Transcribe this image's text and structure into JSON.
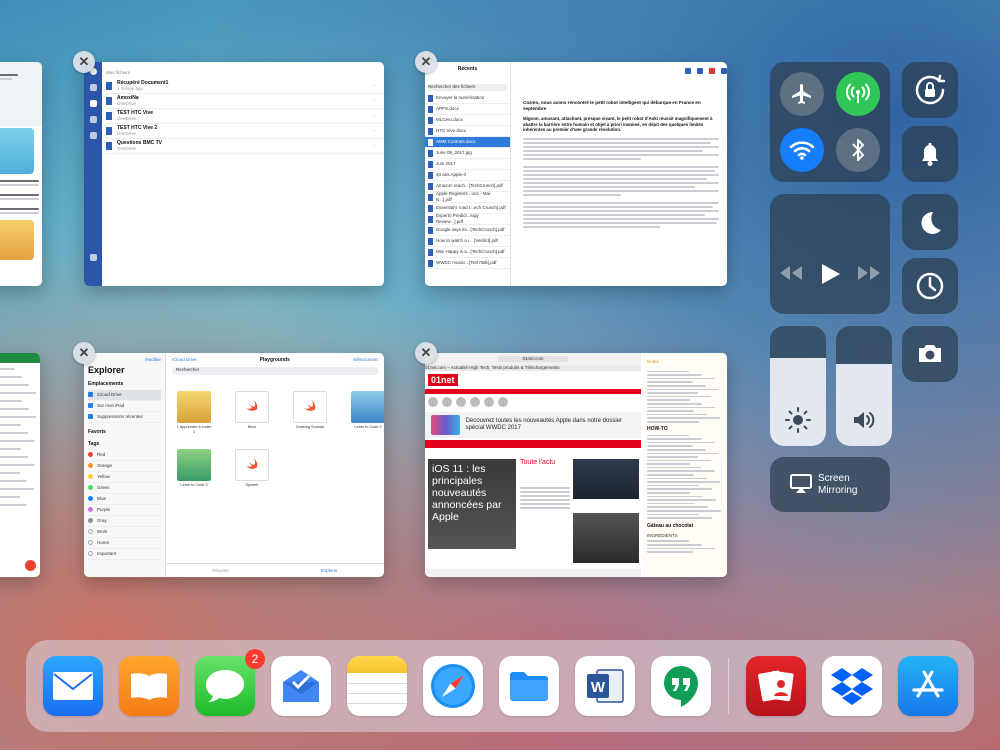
{
  "switcher": {
    "card_docs": {
      "section_label": "Mes fichiers",
      "rows": [
        {
          "name": "Récupéré Document1",
          "meta": "1 minute ago"
        },
        {
          "name": "AmoxiNa",
          "meta": "OneDrive"
        },
        {
          "name": "TEST HTC Vive",
          "meta": "OneDrive"
        },
        {
          "name": "TEST HTC Vive 2",
          "meta": "OneDrive"
        },
        {
          "name": "Questions BMC TV",
          "meta": "OneDrive"
        }
      ],
      "side_items": [
        "Récents",
        "Partagés",
        "Ouvrir",
        "Nouveau"
      ]
    },
    "card_files_doc": {
      "title": "Récents",
      "search_placeholder": "Rechercher des fichiers",
      "list": [
        {
          "name": "Envoyer la numérisation"
        },
        {
          "name": "APPS.docx"
        },
        {
          "name": "MLCero.docx"
        },
        {
          "name": "HTC Vive.docx"
        },
        {
          "name": "AMM Contrats.docx",
          "selected": true
        },
        {
          "name": "June 09_2017.jpg"
        },
        {
          "name": "Juin 2017"
        },
        {
          "name": "40 ans Apple-II"
        },
        {
          "name": "Amazon reach...[TechCrunch].pdf"
        },
        {
          "name": "Apple Registers...ons - Mar N...].pdf"
        },
        {
          "name": "Essential's road t...ech Crunch].pdf"
        },
        {
          "name": "Esperto Predict...logy Review...].pdf"
        },
        {
          "name": "Google says its...[TechCrunch].pdf"
        },
        {
          "name": "How to watch a i... [Verdict].pdf"
        },
        {
          "name": "Mini Happy is a...[TechCrunch].pdf"
        },
        {
          "name": "WWDC music!...[TechTalk].pdf"
        }
      ],
      "doc_heading": "Cozmo, nous avons rencontré le petit robot intelligent qui débarque en France en septembre",
      "doc_lead": "Mignon, amusant, attachant, presque vivant, le petit robot d'Anki réussit magnifiquement à abattre la barrière entre humain et objet à priori inanimé, en dépit des quelques limites inhérentes au premier d'une grande révolution."
    },
    "card_explorer": {
      "title": "Explorer",
      "edit": "Modifier",
      "locations_header": "Emplacements",
      "locations": [
        "iCloud Drive",
        "Sur mon iPad",
        "Suppressions récentes"
      ],
      "favorites_header": "Favoris",
      "tags_header": "Tags",
      "tags": [
        {
          "name": "Red",
          "color": "#fc3d39"
        },
        {
          "name": "Orange",
          "color": "#fd9426"
        },
        {
          "name": "Yellow",
          "color": "#fecb2e"
        },
        {
          "name": "Green",
          "color": "#53d769"
        },
        {
          "name": "Blue",
          "color": "#147efb"
        },
        {
          "name": "Purple",
          "color": "#cc73e1"
        },
        {
          "name": "Gray",
          "color": "#8e8e93"
        },
        {
          "name": "Work",
          "color": "#ffffff"
        },
        {
          "name": "Home",
          "color": "#ffffff"
        },
        {
          "name": "Important",
          "color": "#ffffff"
        }
      ],
      "back": "iCloud Drive",
      "folder_title": "Playgrounds",
      "select": "Sélectionner",
      "search_placeholder": "Rechercher",
      "files": [
        "1 Apprendre à coder 1",
        "Blink",
        "Drawing Sounds",
        "Learn to Code 2",
        "Learn to Code 3",
        "Spinner"
      ],
      "bottom_tabs": [
        "Récents",
        "Explorer"
      ]
    },
    "card_web": {
      "url": "01net.com",
      "site": "01net",
      "tagline": "01net.com – Actualité High Tech, Tests produits & Téléchargements",
      "banner": "Découvrez toutes les nouveautés Apple dans notre dossier spécial WWDC 2017",
      "headline": "iOS 11 : les principales nouveautés annoncées par Apple",
      "side_label": "Toute l'actu",
      "notes_title": "Notes",
      "notes_section1": "HOW-TO",
      "notes_section2": "Gâteau au chocolat",
      "notes_section3": "INGRÉDIENTS"
    }
  },
  "control_center": {
    "screen_mirroring_label": "Screen\nMirroring",
    "brightness_level": 0.73,
    "volume_level": 0.68,
    "airplane_on": false,
    "cellular_on": true,
    "wifi_on": true,
    "bluetooth_on": false
  },
  "dock": {
    "apps": [
      {
        "name": "Mail",
        "icon": "mail-icon"
      },
      {
        "name": "iBooks",
        "icon": "book-icon"
      },
      {
        "name": "Messages",
        "icon": "message-icon",
        "badge": "2"
      },
      {
        "name": "Inbox",
        "icon": "inbox-icon"
      },
      {
        "name": "Notes",
        "icon": "notes-icon"
      },
      {
        "name": "Safari",
        "icon": "compass-icon"
      },
      {
        "name": "Files",
        "icon": "folder-icon"
      },
      {
        "name": "Word",
        "icon": "word-icon"
      },
      {
        "name": "Hangouts",
        "icon": "hangouts-icon"
      },
      {
        "name": "Photo Booth",
        "icon": "photo-cards-icon"
      },
      {
        "name": "Dropbox",
        "icon": "dropbox-icon"
      },
      {
        "name": "App Store",
        "icon": "appstore-icon"
      }
    ],
    "colors": {
      "mail": "#1e7cf2",
      "books": "#f7931e",
      "messages": "#35c759",
      "word": "#2b579a",
      "appstore": "#1a8ef0"
    }
  }
}
